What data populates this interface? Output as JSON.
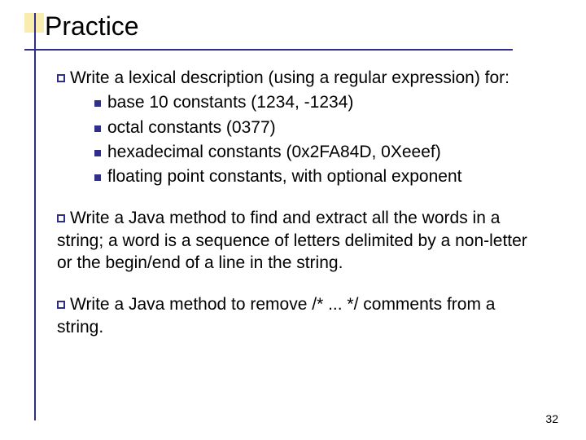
{
  "title": "Practice",
  "bullets": [
    {
      "lead": "Write a lexical description (using a regular expression) for:",
      "subs": [
        "base 10 constants (1234, -1234)",
        "octal constants (0377)",
        "hexadecimal constants (0x2FA84D, 0Xeeef)",
        "floating point constants, with optional exponent"
      ]
    },
    {
      "lead": "Write a Java method to find and extract all the words in a string; a word is a sequence of letters delimited by a non-letter or the begin/end of a line in the string."
    },
    {
      "lead": "Write a Java method to remove /* ... */ comments from a string."
    }
  ],
  "page_number": "32"
}
